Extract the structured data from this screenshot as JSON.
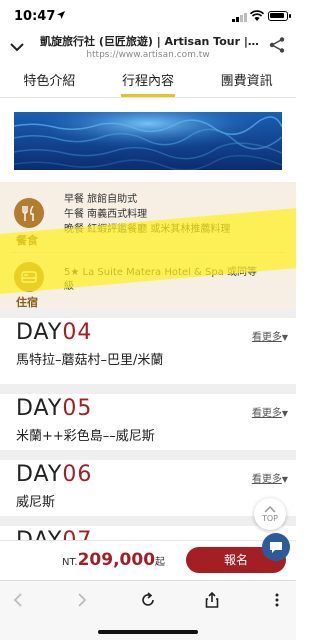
{
  "status_bar": {
    "time": "10:47"
  },
  "browser": {
    "page_title": "凱旋旅行社 (巨匠旅遊) | Artisan Tour | ...",
    "url": "https://www.artisan.com.tw"
  },
  "tabs": [
    {
      "label": "特色介紹",
      "active": false
    },
    {
      "label": "行程內容",
      "active": true
    },
    {
      "label": "團費資訊",
      "active": false
    }
  ],
  "info_card": {
    "meal_label": "餐食",
    "meals": [
      "早餐 旅館自助式",
      "午餐 南義西式料理",
      "晚餐 紅蝦評鑑餐廳 或米其林推薦料理"
    ],
    "hotel_label": "住宿",
    "hotel": "5★ La Suite Matera Hotel & Spa 或同等級"
  },
  "days": [
    {
      "prefix": "DAY",
      "number": "04",
      "route": "馬特拉–蘑菇村–巴里/米蘭",
      "more": "看更多"
    },
    {
      "prefix": "DAY",
      "number": "05",
      "route": "米蘭++彩色島––威尼斯",
      "more": "看更多"
    },
    {
      "prefix": "DAY",
      "number": "06",
      "route": "威尼斯",
      "more": "看更多"
    },
    {
      "prefix": "DAY",
      "number": "07",
      "route": "",
      "more": ""
    }
  ],
  "top_button": "TOP",
  "price_bar": {
    "currency": "NT.",
    "amount": "209,000",
    "suffix": "起",
    "signup": "報名"
  },
  "colors": {
    "accent": "#a31f24",
    "tab_underline": "#e7c31f",
    "icon_brown": "#b27d2e",
    "card_bg": "#f7efe4"
  }
}
